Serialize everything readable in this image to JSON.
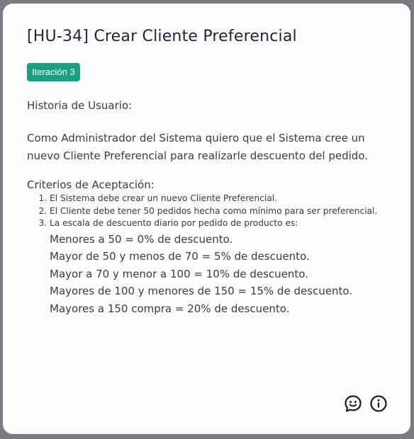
{
  "card": {
    "title": "[HU-34] Crear Cliente Preferencial",
    "badge": "Iteración 3",
    "story_heading": "Historia de Usuario:",
    "story_text": "Como Administrador del Sistema quiero que el Sistema cree un nuevo Cliente Preferencial para realizarle descuento del pedido.",
    "criteria_heading": "Criterios de Aceptación:",
    "criteria": [
      "El Sistema debe crear un nuevo Cliente Preferencial.",
      "El Cliente debe tener 50 pedidos hecha como mínimo para ser preferencial.",
      "La escala de descuento diario por pedido de producto es:"
    ],
    "discount_scale": [
      "Menores a 50 = 0% de descuento.",
      "Mayor de 50 y menos de 70 = 5% de descuento.",
      "Mayor a 70 y menor a 100 = 10% de descuento.",
      "Mayores de 100 y menores de 150 = 15% de descuento.",
      "Mayores a 150 compra = 20% de descuento."
    ]
  },
  "icons": {
    "comment": "comment-smile-icon",
    "info": "info-icon"
  },
  "colors": {
    "badge_bg": "#1aa082",
    "title": "#23233a",
    "text": "#3b3b4a",
    "card_bg": "#fbfbfc",
    "backdrop": "#7a7b80"
  }
}
